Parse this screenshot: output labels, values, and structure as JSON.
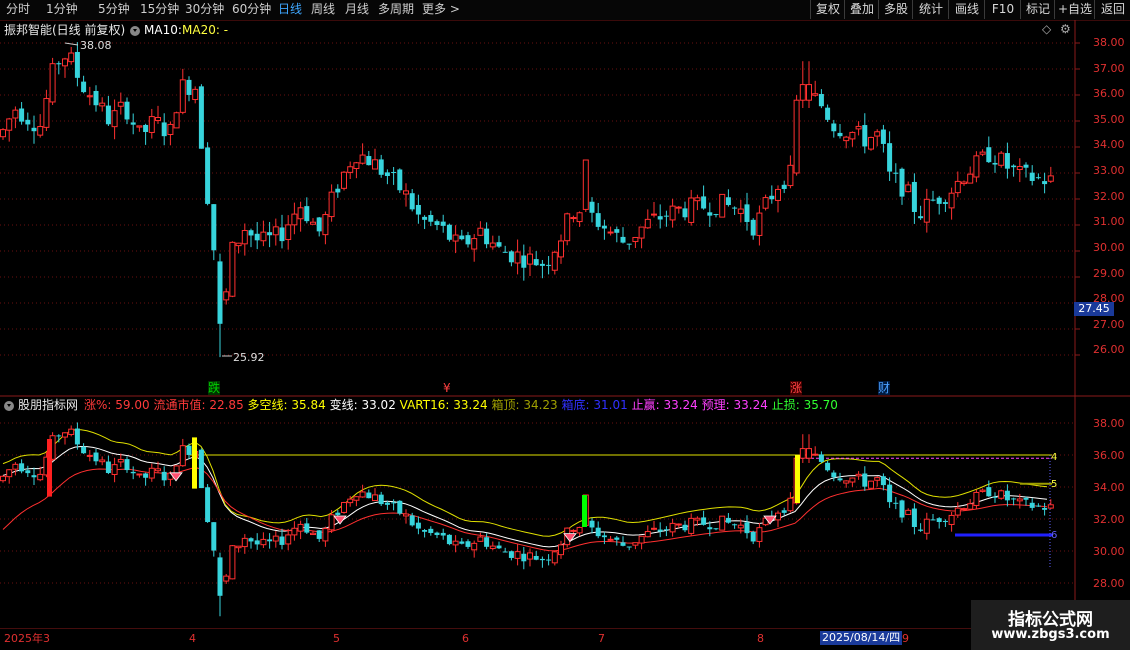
{
  "toolbar": {
    "periods": [
      "分时",
      "1分钟",
      "5分钟",
      "15分钟",
      "30分钟",
      "60分钟",
      "日线",
      "周线",
      "月线",
      "多周期",
      "更多 >"
    ],
    "active_period": "日线",
    "right_buttons": [
      "复权",
      "叠加",
      "多股",
      "统计",
      "画线",
      "F10",
      "标记",
      "+自选",
      "返回"
    ]
  },
  "main_chart": {
    "title": "振邦智能(日线 前复权)",
    "ma10_label": "MA10:",
    "ma20_label": "MA20: -",
    "high_label": "38.08",
    "low_label": "25.92",
    "price_tag": "27.45",
    "y_ticks": [
      "38.00",
      "37.00",
      "36.00",
      "35.00",
      "34.00",
      "33.00",
      "32.00",
      "31.00",
      "30.00",
      "29.00",
      "28.00",
      "27.00",
      "26.00"
    ],
    "event_markers": [
      {
        "text": "跌",
        "color": "#00d000"
      },
      {
        "text": "¥",
        "color": "#ff4040"
      },
      {
        "text": "涨",
        "color": "#ff4040"
      },
      {
        "text": "财",
        "color": "#4aa0ff"
      }
    ],
    "up_color": "#ff3030",
    "down_color": "#37d4dc"
  },
  "indicator": {
    "name": "股朋指标网",
    "items": [
      {
        "label": "涨%:",
        "value": "59.00",
        "color": "#ff3a3a"
      },
      {
        "label": "流通市值:",
        "value": "22.85",
        "color": "#ff3a3a"
      },
      {
        "label": "多空线:",
        "value": "35.84",
        "color": "#ffff00"
      },
      {
        "label": "变线:",
        "value": "33.02",
        "color": "#ffffff"
      },
      {
        "label": "VART16:",
        "value": "33.24",
        "color": "#ffff00"
      },
      {
        "label": "箱顶:",
        "value": "34.23",
        "color": "#a0a000"
      },
      {
        "label": "箱底:",
        "value": "31.01",
        "color": "#3030ff"
      },
      {
        "label": "止赢:",
        "value": "33.24",
        "color": "#ff40ff"
      },
      {
        "label": "预理:",
        "value": "33.24",
        "color": "#ff40ff"
      },
      {
        "label": "止损:",
        "value": "35.70",
        "color": "#30ff30"
      }
    ],
    "y_ticks": [
      "38.00",
      "36.00",
      "34.00",
      "32.00",
      "30.00",
      "28.00"
    ],
    "right_markers": [
      "4",
      "5",
      "6"
    ]
  },
  "time_axis": {
    "labels": [
      "2025年3",
      "4",
      "5",
      "6",
      "7",
      "8",
      "2025/08/14/四",
      "9"
    ]
  },
  "watermark": {
    "line1": "指标公式网",
    "line2": "www.zbgs3.com"
  }
}
